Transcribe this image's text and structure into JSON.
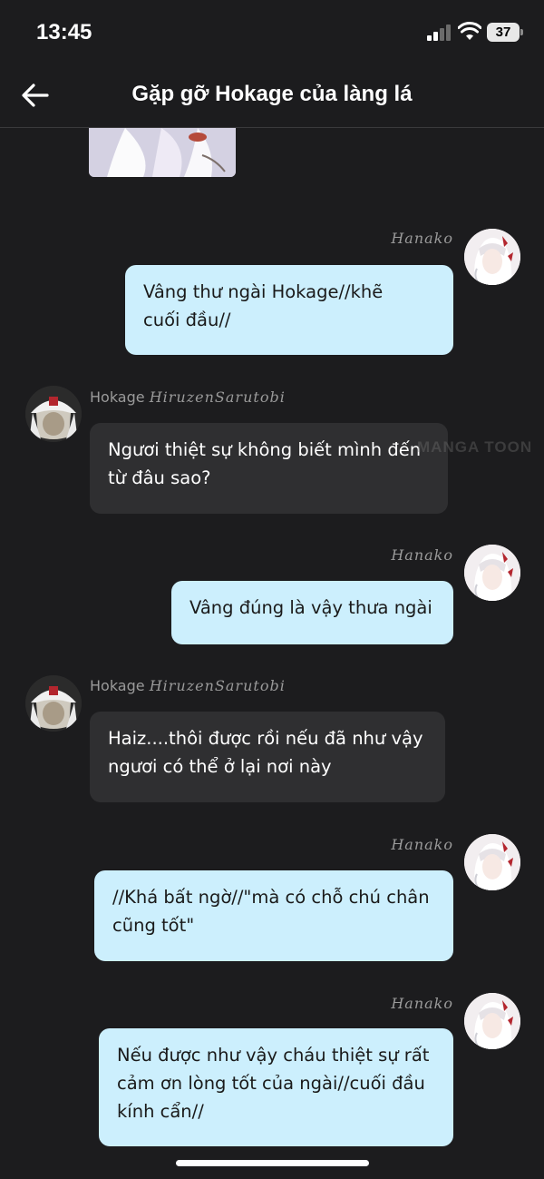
{
  "status_bar": {
    "time": "13:45",
    "battery": "37"
  },
  "header": {
    "title": "Gặp gỡ Hokage của làng lá"
  },
  "watermark": "MANGA TOON",
  "messages": [
    {
      "side": "right",
      "name": "Hanako",
      "text": "Vâng thư ngài Hokage//khẽ\ncuối đầu//"
    },
    {
      "side": "left",
      "name_prefix": "Hokage",
      "name": "HiruzenSarutobi",
      "text": "Ngươi thiệt sự không biết mình đến\ntừ đâu sao?"
    },
    {
      "side": "right",
      "name": "Hanako",
      "text": "Vâng đúng là vậy thưa ngài"
    },
    {
      "side": "left",
      "name_prefix": "Hokage",
      "name": "HiruzenSarutobi",
      "text": "Haiz....thôi được rồi nếu đã như vậy\nngươi có thể ở lại nơi này"
    },
    {
      "side": "right",
      "name": "Hanako",
      "text": "//Khá bất ngờ//\"mà có chỗ chú chân\ncũng tốt\""
    },
    {
      "side": "right",
      "name": "Hanako",
      "text": "Nếu được như vậy cháu thiệt sự rất\ncảm ơn lòng tốt của ngài//cuối đầu\nkính cẩn//"
    }
  ],
  "icons": {
    "back": "arrow-left-icon",
    "signal": "cellular-signal-icon",
    "wifi": "wifi-icon",
    "battery": "battery-icon"
  },
  "colors": {
    "background": "#1c1c1e",
    "outgoing_bubble": "#cceffd",
    "incoming_bubble": "#2f2f31",
    "name_text": "#9a9a9a"
  }
}
